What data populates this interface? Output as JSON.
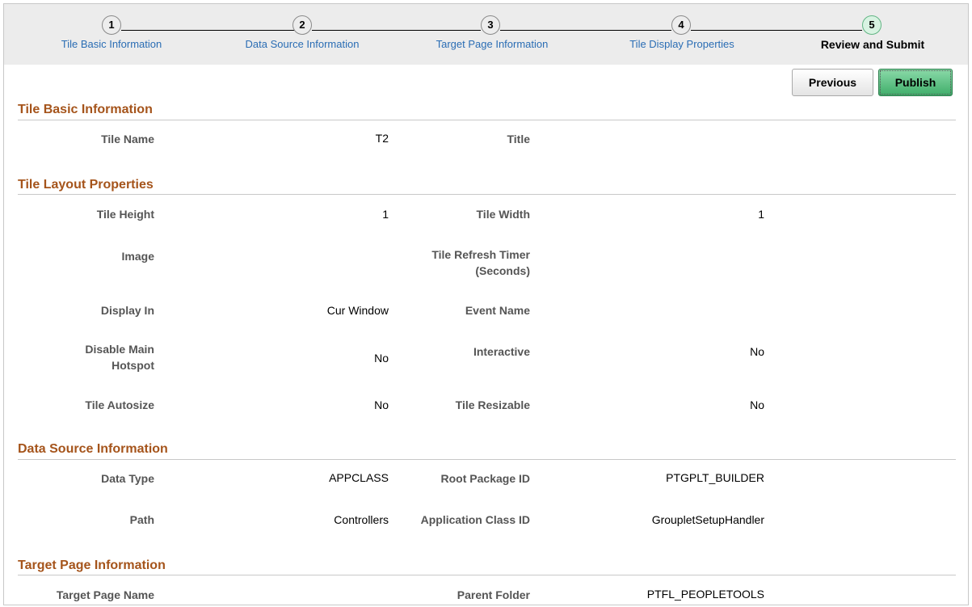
{
  "train": {
    "steps": [
      {
        "number": "1",
        "label": "Tile Basic Information"
      },
      {
        "number": "2",
        "label": "Data Source Information"
      },
      {
        "number": "3",
        "label": "Target Page Information"
      },
      {
        "number": "4",
        "label": "Tile Display Properties"
      },
      {
        "number": "5",
        "label": "Review and Submit"
      }
    ]
  },
  "buttons": {
    "previous": "Previous",
    "publish": "Publish"
  },
  "sections": {
    "basic": {
      "title": "Tile Basic Information",
      "tile_name_label": "Tile Name",
      "tile_name_value": "T2",
      "title_label": "Title"
    },
    "layout": {
      "title": "Tile Layout Properties",
      "tile_height_label": "Tile Height",
      "tile_height_value": "1",
      "tile_width_label": "Tile Width",
      "tile_width_value": "1",
      "image_label": "Image",
      "refresh_label_1": "Tile Refresh Timer",
      "refresh_label_2": "(Seconds)",
      "display_in_label": "Display In",
      "display_in_value": "Cur Window",
      "event_name_label": "Event Name",
      "disable_main_label_1": "Disable Main",
      "disable_main_label_2": "Hotspot",
      "disable_main_value": "No",
      "interactive_label": "Interactive",
      "interactive_value": "No",
      "autosize_label": "Tile Autosize",
      "autosize_value": "No",
      "resizable_label": "Tile Resizable",
      "resizable_value": "No"
    },
    "datasource": {
      "title": "Data Source Information",
      "data_type_label": "Data Type",
      "data_type_value": "APPCLASS",
      "root_pkg_label": "Root Package ID",
      "root_pkg_value": "PTGPLT_BUILDER",
      "path_label": "Path",
      "path_value": "Controllers",
      "app_class_label": "Application Class ID",
      "app_class_value": "GroupletSetupHandler"
    },
    "target": {
      "title": "Target Page Information",
      "target_page_label": "Target Page Name",
      "parent_folder_label": "Parent Folder",
      "parent_folder_value": "PTFL_PEOPLETOOLS"
    }
  }
}
